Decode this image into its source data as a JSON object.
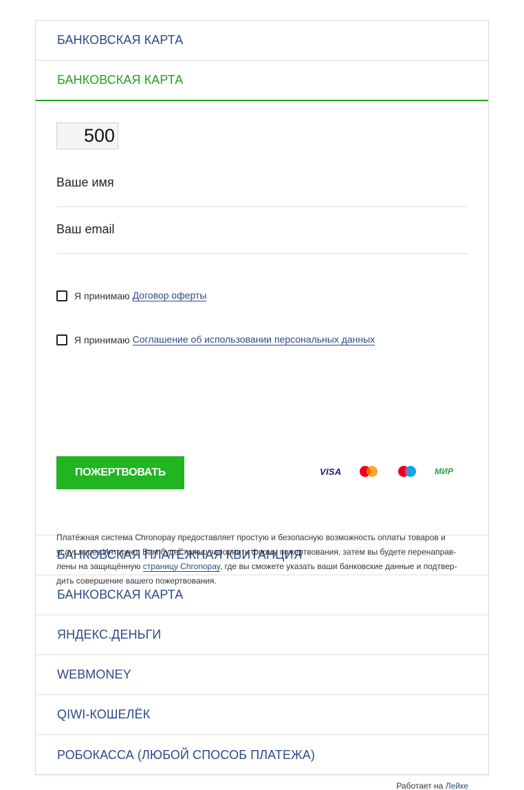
{
  "tabs_top": [
    {
      "label": "БАНКОВСКАЯ КАРТА",
      "active": false
    },
    {
      "label": "БАНКОВСКАЯ КАРТА",
      "active": true
    }
  ],
  "form": {
    "amount": "500",
    "name_placeholder": "Ваше имя",
    "email_placeholder": "Ваш email",
    "consent_offer": {
      "prefix": "Я принимаю",
      "link": "Договор оферты"
    },
    "consent_personal": {
      "prefix": "Я принимаю",
      "link": "Соглашение об использовании персональных данных"
    },
    "donate_button": "ПОЖЕРТВОВАТЬ",
    "payment_logos": [
      {
        "name": "visa",
        "text": "VISA"
      },
      {
        "name": "mastercard",
        "text": ""
      },
      {
        "name": "maestro",
        "text": ""
      },
      {
        "name": "mir",
        "text": "МИР"
      }
    ],
    "info": {
      "line1": "Платёжная система Chronopay предоставляет простую и безопасную возможность оплаты товаров и",
      "line2": "услуг через Интернет. Вам будет нужно заполнить форму пожертвования, затем вы будете перенаправ-",
      "line3_before": "лены на защищённую ",
      "line3_link": "страницу Chronopay",
      "line3_after": ", где вы сможете указать ваши банковские данные и подтвер-",
      "line4": "дить совершение вашего пожертвования."
    }
  },
  "tabs_bottom": [
    {
      "label": "БАНКОВСКАЯ ПЛАТЁЖНАЯ КВИТАНЦИЯ"
    },
    {
      "label": "БАНКОВСКАЯ КАРТА"
    },
    {
      "label": "ЯНДЕКС.ДЕНЬГИ"
    },
    {
      "label": "WEBMONEY"
    },
    {
      "label": "QIWI-КОШЕЛЁК"
    },
    {
      "label": "РОБОКАССА (ЛЮБОЙ СПОСОБ ПЛАТЕЖА)"
    }
  ],
  "footer": {
    "prefix": "Работает на",
    "link": "Лейке"
  },
  "colors": {
    "accent_green": "#21b521",
    "link_blue": "#2c4a87",
    "active_tab": "#21a321"
  }
}
